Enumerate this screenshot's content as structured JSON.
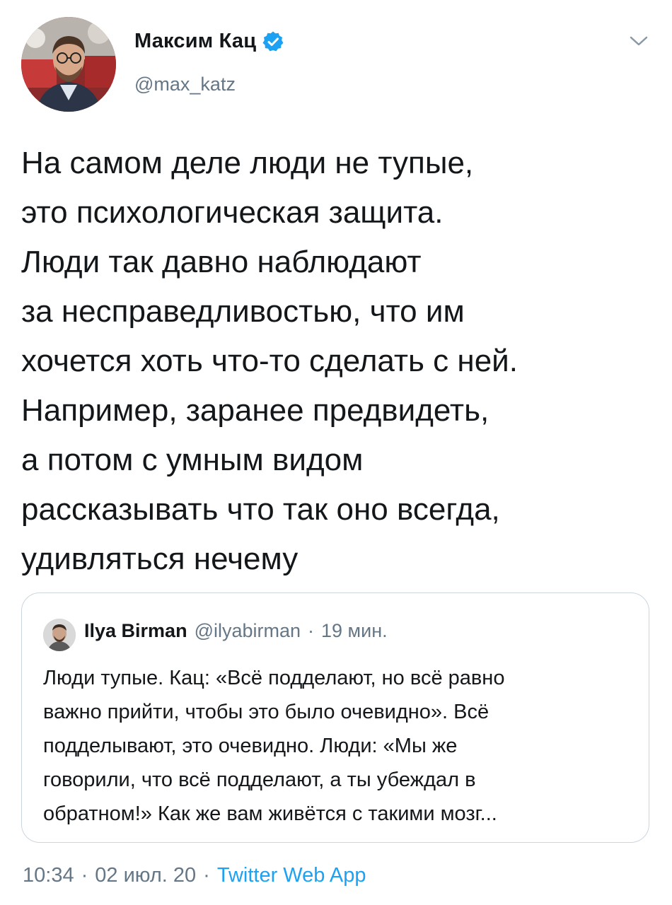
{
  "author": {
    "name": "Максим Кац",
    "handle": "@max_katz",
    "verified": true
  },
  "colors": {
    "text": "#14171a",
    "secondary": "#657786",
    "accent": "#1da1f2",
    "border": "#ccd6dd"
  },
  "tweet": {
    "text": "На самом деле люди не тупые,\nэто психологическая защита.\nЛюди так давно наблюдают\nза несправедливостью, что им\nхочется хоть что-то сделать с ней.\nНапример, заранее предвидеть,\nа потом с умным видом\nрассказывать что так оно всегда,\nудивляться нечему"
  },
  "quote": {
    "name": "Ilya Birman",
    "handle": "@ilyabirman",
    "separator": "·",
    "time": "19 мин.",
    "text": "Люди тупые. Кац: «Всё подделают, но всё равно\nважно прийти, чтобы это было очевидно». Всё\nподделывают, это очевидно. Люди: «Мы же\nговорили, что всё подделают, а ты убеждал в\nобратном!» Как же вам живётся с такими мозг..."
  },
  "footer": {
    "time": "10:34",
    "sep1": "·",
    "date": "02 июл. 20",
    "sep2": "·",
    "source": "Twitter Web App"
  },
  "icons": {
    "verified": "verified-badge-icon",
    "menu": "chevron-down-icon"
  }
}
